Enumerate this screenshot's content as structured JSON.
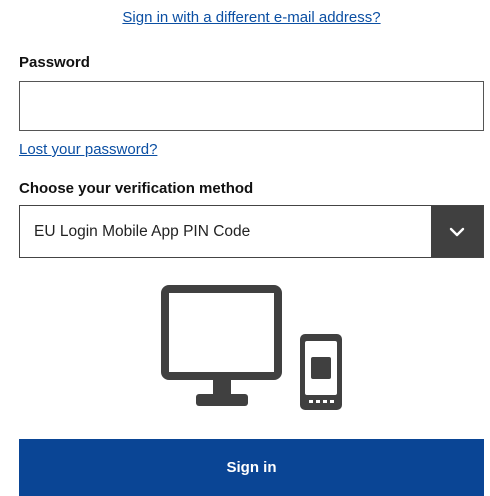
{
  "links": {
    "different_email": "Sign in with a different e-mail address?",
    "lost_password": "Lost your password?"
  },
  "password": {
    "label": "Password",
    "value": "",
    "placeholder": ""
  },
  "verification": {
    "label": "Choose your verification method",
    "selected": "EU Login Mobile App PIN Code",
    "icon": "chevron-down-icon"
  },
  "illustration": {
    "icon": "desktop-and-mobile-icon"
  },
  "actions": {
    "sign_in_label": "Sign in"
  },
  "colors": {
    "link": "#0b4fa3",
    "primary_button": "#0a4595",
    "select_button": "#404040",
    "illustration": "#404040"
  }
}
